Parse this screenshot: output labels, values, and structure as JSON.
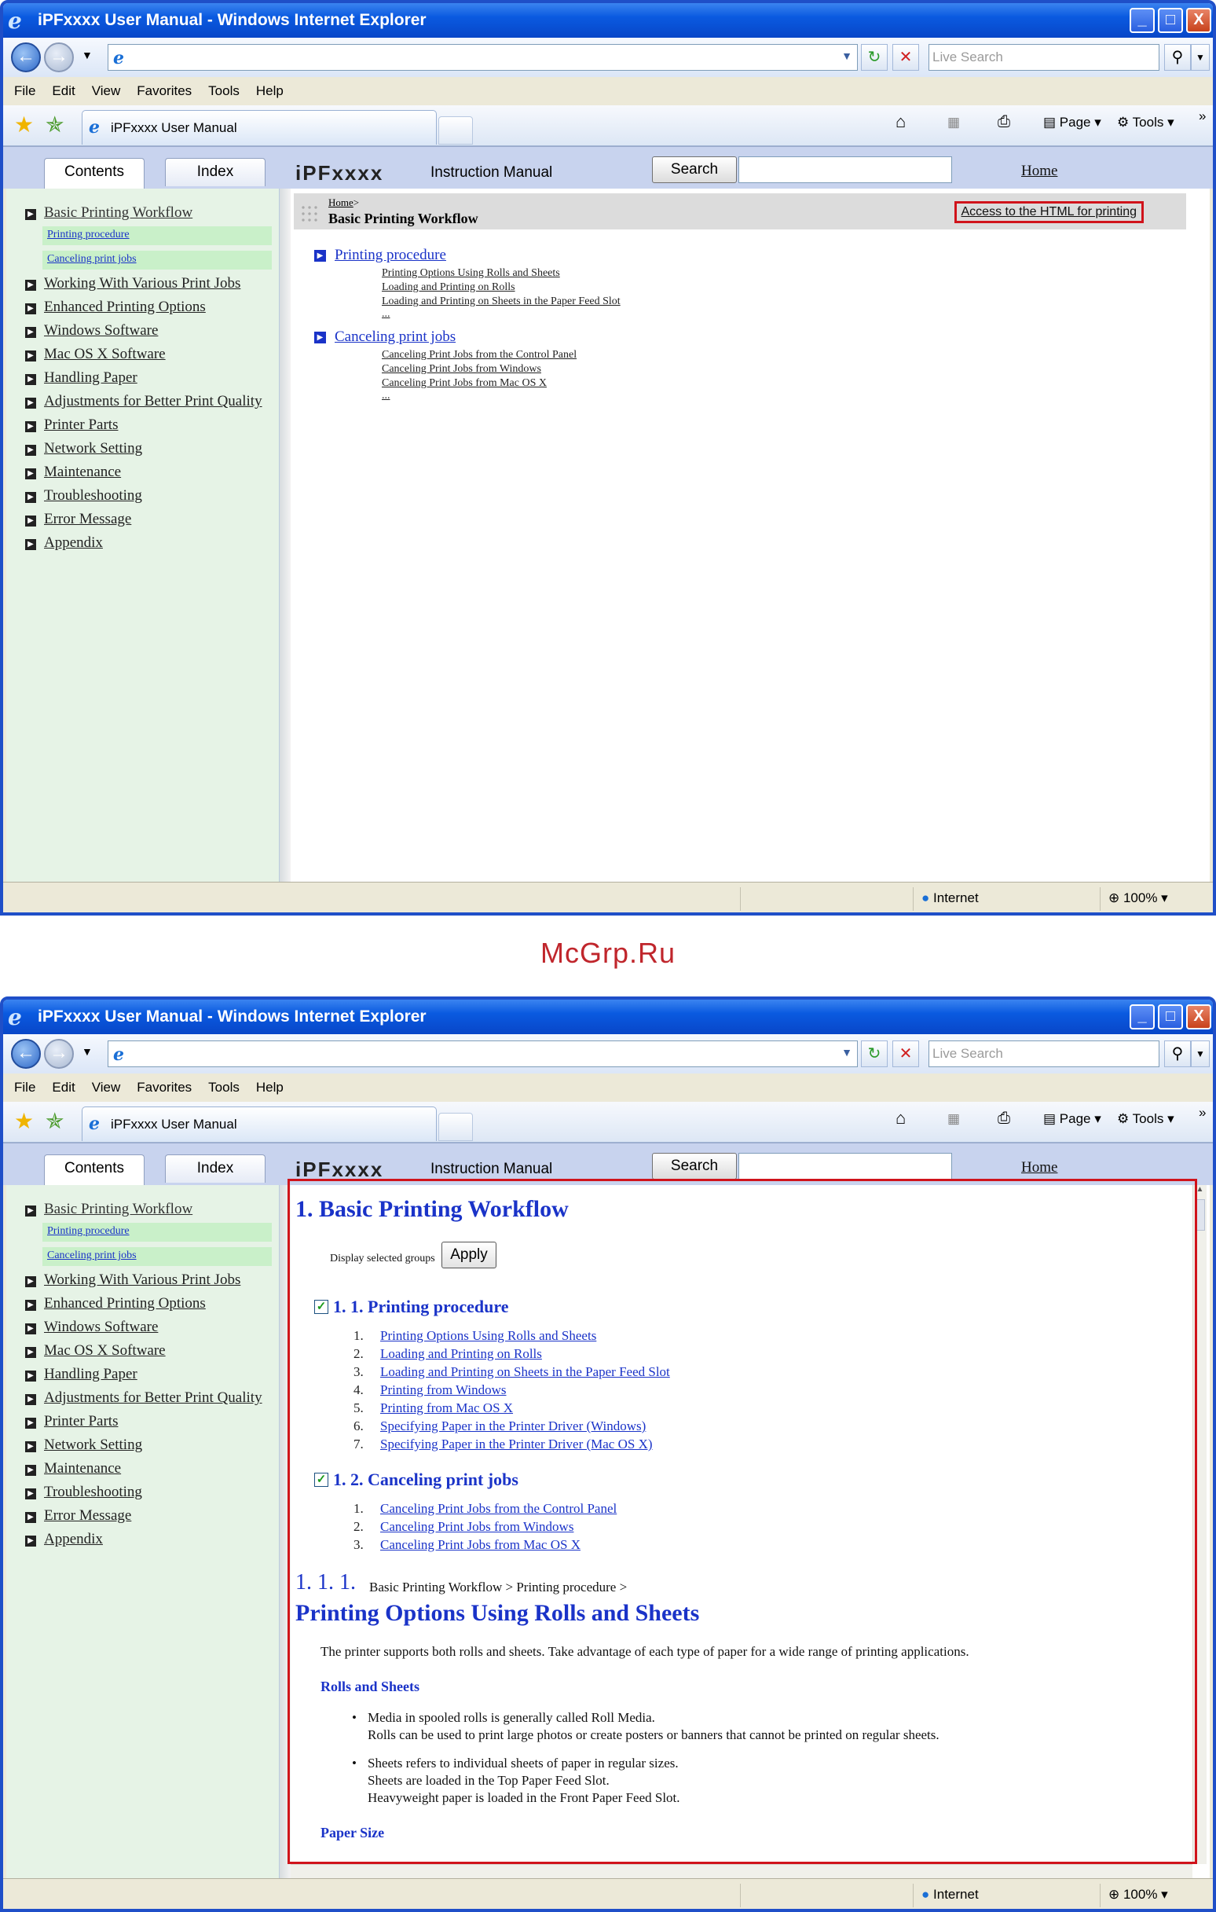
{
  "window": {
    "title": "iPFxxxx User Manual - Windows Internet Explorer"
  },
  "toolbar": {
    "live_search_placeholder": "Live Search",
    "minimize": "_",
    "maximize": "□",
    "close": "X"
  },
  "menu": [
    "File",
    "Edit",
    "View",
    "Favorites",
    "Tools",
    "Help"
  ],
  "browser_tab": {
    "label": "iPFxxxx User Manual"
  },
  "command_bar": {
    "page": "Page",
    "tools": "Tools"
  },
  "header": {
    "contents_tab": "Contents",
    "index_tab": "Index",
    "brand": "iPFxxxx",
    "manual": "Instruction Manual",
    "search_button": "Search",
    "home_link": "Home"
  },
  "sidebar": {
    "items": [
      "Basic Printing Workflow",
      "Working With Various Print Jobs",
      "Enhanced Printing Options",
      "Windows Software",
      "Mac OS X Software",
      "Handling Paper",
      "Adjustments for Better Print Quality",
      "Printer Parts",
      "Network Setting",
      "Maintenance",
      "Troubleshooting",
      "Error Message",
      "Appendix"
    ],
    "subitems": [
      "Printing procedure",
      "Canceling print jobs"
    ]
  },
  "status": {
    "zone": "Internet",
    "zoom": "100%"
  },
  "screen1": {
    "breadcrumb_home": "Home",
    "breadcrumb_sep": ">",
    "page_title": "Basic Printing Workflow",
    "print_link": "Access to the HTML for printing",
    "sections": [
      {
        "title": "Printing procedure",
        "links": [
          "Printing Options Using Rolls and Sheets",
          "Loading and Printing on Rolls",
          "Loading and Printing on Sheets in the Paper Feed Slot"
        ],
        "more": "..."
      },
      {
        "title": "Canceling print jobs",
        "links": [
          "Canceling Print Jobs from the Control Panel",
          "Canceling Print Jobs from Windows",
          "Canceling Print Jobs from Mac OS X"
        ],
        "more": "..."
      }
    ]
  },
  "watermark": "McGrp.Ru",
  "screen2": {
    "heading": "1. Basic Printing Workflow",
    "display_label": "Display selected groups",
    "apply_button": "Apply",
    "group1": {
      "title": "1. 1. Printing procedure",
      "items": [
        "Printing Options Using Rolls and Sheets",
        "Loading and Printing on Rolls",
        "Loading and Printing on Sheets in the Paper Feed Slot",
        "Printing from Windows",
        "Printing from Mac OS X",
        "Specifying Paper in the Printer Driver (Windows)",
        "Specifying Paper in the Printer Driver (Mac OS X)"
      ]
    },
    "group2": {
      "title": "1. 2. Canceling print jobs",
      "items": [
        "Canceling Print Jobs from the Control Panel",
        "Canceling Print Jobs from Windows",
        "Canceling Print Jobs from Mac OS X"
      ]
    },
    "topic_number": "1. 1. 1.",
    "topic_path": "Basic Printing Workflow > Printing procedure >",
    "topic_title": "Printing Options Using Rolls and Sheets",
    "intro": "The printer supports both rolls and sheets. Take advantage of each type of paper for a wide range of printing applications.",
    "rolls_heading": "Rolls and Sheets",
    "bullet1_line1": "Media in spooled rolls is generally called Roll Media.",
    "bullet1_line2": "Rolls can be used to print large photos or create posters or banners that cannot be printed on regular sheets.",
    "bullet2_line1": "Sheets refers to individual sheets of paper in regular sizes.",
    "bullet2_line2": "Sheets are loaded in the Top Paper Feed Slot.",
    "bullet2_line3": "Heavyweight paper is loaded in the Front Paper Feed Slot.",
    "paper_size_heading": "Paper Size"
  }
}
